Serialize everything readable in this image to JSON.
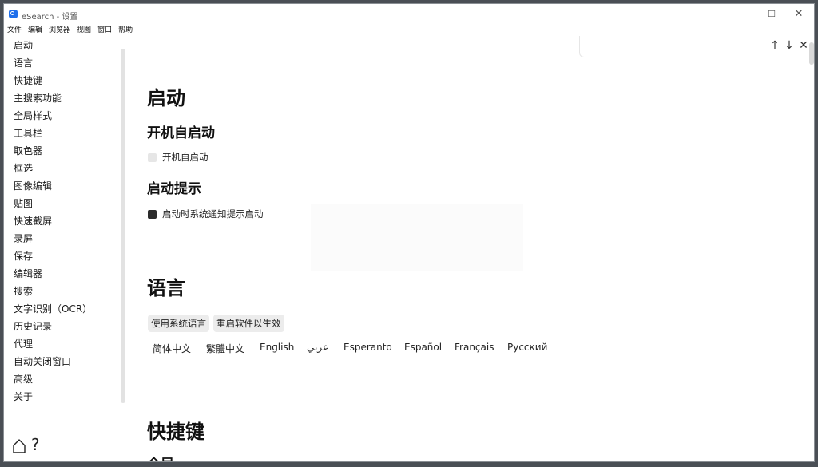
{
  "window": {
    "title": "eSearch - 设置",
    "controls": {
      "minimize": "—",
      "maximize": "☐",
      "close": "✕"
    }
  },
  "menubar": [
    "文件",
    "编辑",
    "浏览器",
    "视图",
    "窗口",
    "帮助"
  ],
  "sidebar": {
    "items": [
      "启动",
      "语言",
      "快捷键",
      "主搜索功能",
      "全局样式",
      "工具栏",
      "取色器",
      "框选",
      "图像编辑",
      "贴图",
      "快速截屏",
      "录屏",
      "保存",
      "编辑器",
      "搜索",
      "文字识别（OCR）",
      "历史记录",
      "代理",
      "自动关闭窗口",
      "高级",
      "关于"
    ],
    "footer_icons": {
      "home": "home-icon",
      "help": "?"
    }
  },
  "find_bar": {
    "up": "↑",
    "down": "↓",
    "close": "✕"
  },
  "content": {
    "startup": {
      "title": "启动",
      "autostart_heading": "开机自启动",
      "autostart_label": "开机自启动",
      "autostart_checked": false,
      "hint_heading": "启动提示",
      "hint_label": "启动时系统通知提示启动",
      "hint_checked": true
    },
    "language": {
      "title": "语言",
      "buttons": [
        "使用系统语言",
        "重启软件以生效"
      ],
      "options": [
        "简体中文",
        "繁體中文",
        "English",
        "عربي",
        "Esperanto",
        "Español",
        "Français",
        "Русский"
      ]
    },
    "shortcuts": {
      "title": "快捷键",
      "next_heading": "全局"
    }
  },
  "colors": {
    "checked": "#2b2b2b",
    "unchecked": "#e6e6e6",
    "button_bg": "#ececec",
    "icon": "#1f6feb"
  }
}
